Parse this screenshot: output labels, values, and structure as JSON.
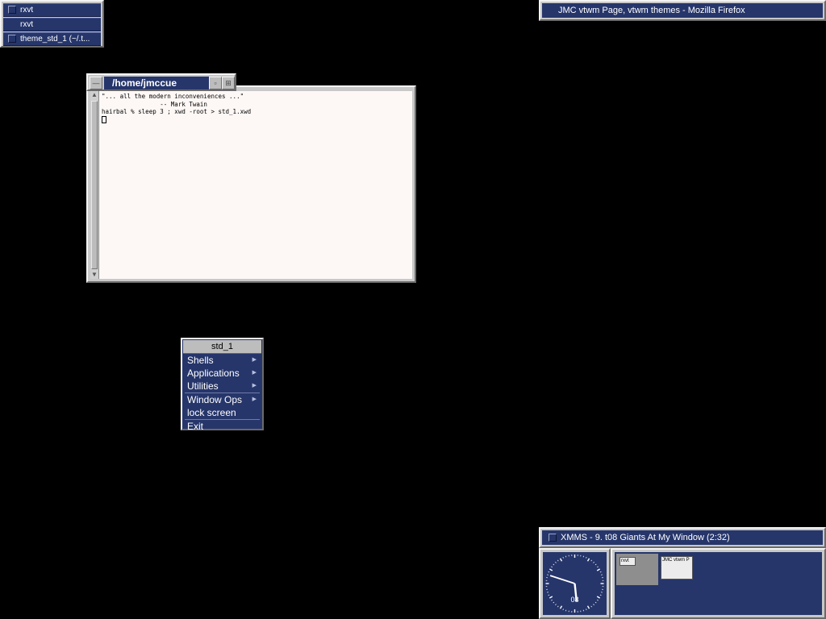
{
  "icon_manager": {
    "items": [
      {
        "label": "rxvt"
      },
      {
        "label": "rxvt"
      },
      {
        "label": "theme_std_1 (~/.t..."
      }
    ]
  },
  "firefox": {
    "title": "JMC vtwm Page, vtwm themes - Mozilla Firefox"
  },
  "terminal": {
    "title": "/home/jmccue",
    "lines": [
      "\"... all the modern inconveniences ...\"",
      "                -- Mark Twain",
      "hairbal % sleep 3 ; xwd -root > std_1.xwd"
    ]
  },
  "menu": {
    "title": "std_1",
    "items": [
      {
        "label": "Shells",
        "submenu": true
      },
      {
        "label": "Applications",
        "submenu": true
      },
      {
        "label": "Utilities",
        "submenu": true
      },
      {
        "label": "Window Ops",
        "submenu": true
      },
      {
        "label": "lock screen",
        "submenu": false
      },
      {
        "label": "Exit",
        "submenu": false
      }
    ]
  },
  "xmms": {
    "title": "XMMS - 9. t08 Giants At My Window (2:32)"
  },
  "clock": {
    "label": "08",
    "hour": 5,
    "minute": 48
  },
  "pager": {
    "windows": [
      {
        "label": "rxvt"
      },
      {
        "label": "JMC vtwm P"
      }
    ]
  },
  "colors": {
    "titlebar": "#26366b",
    "frame": "#c8c8c8",
    "desktop": "#000000",
    "terminal_bg": "#fdf8f6"
  }
}
